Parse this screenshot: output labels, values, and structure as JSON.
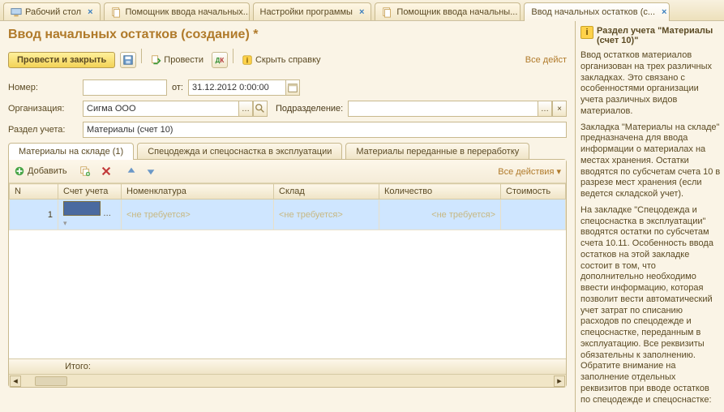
{
  "top_tabs": [
    {
      "label": "Рабочий стол",
      "closable": true,
      "icon": "desktop"
    },
    {
      "label": "Помощник ввода начальных...",
      "closable": true,
      "icon": "doclist"
    },
    {
      "label": "Настройки программы",
      "closable": true
    },
    {
      "label": "Помощник ввода начальны...",
      "closable": true,
      "icon": "doclist"
    },
    {
      "label": "Ввод начальных остатков (с...",
      "closable": true,
      "active": true
    }
  ],
  "page_title": "Ввод начальных остатков (создание) *",
  "toolbar": {
    "primary": "Провести и закрыть",
    "post": "Провести",
    "hide_help": "Скрыть справку",
    "all_actions": "Все дейст"
  },
  "fields": {
    "number_label": "Номер:",
    "number_value": "",
    "from_label": "от:",
    "date_value": "31.12.2012 0:00:00",
    "org_label": "Организация:",
    "org_value": "Сигма ООО",
    "dept_label": "Подразделение:",
    "dept_value": "",
    "section_label": "Раздел учета:",
    "section_value": "Материалы (счет 10)"
  },
  "subtabs": [
    "Материалы на складе (1)",
    "Спецодежда и спецоснастка в эксплуатации",
    "Материалы переданные в переработку"
  ],
  "grid_toolbar": {
    "add": "Добавить",
    "all_actions": "Все действия"
  },
  "grid": {
    "cols": [
      "N",
      "Счет учета",
      "Номенклатура",
      "Склад",
      "Количество",
      "Стоимость"
    ],
    "row": {
      "n": "1",
      "account": "",
      "nomen": "<не требуется>",
      "sklad": "<не требуется>",
      "qty": "<не требуется>",
      "cost": ""
    },
    "footer_label": "Итого:"
  },
  "help": {
    "title": "Раздел учета \"Материалы (счет 10)\"",
    "p1": "Ввод остатков материалов организован на трех различных закладках. Это связано с особенностями организации учета различных видов материалов.",
    "p2": "Закладка \"Материалы на складе\" предназначена для ввода информации о материалах на местах хранения. Остатки вводятся по субсчетам счета 10 в разрезе мест хранения (если ведется складской учет).",
    "p3": "На закладке \"Спецодежда и спецоснастка в эксплуатации\" вводятся остатки по субсчетам счета 10.11. Особенность ввода остатков на этой закладке состоит в том, что дополнительно необходимо ввести информацию, которая позволит вести автоматический учет затрат по списанию расходов по спецодежде и спецоснастке, переданным в эксплуатацию. Все реквизиты обязательны к заполнению. Обратите внимание на заполнение отдельных реквизитов при вводе остатков по спецодежде и спецоснастке:"
  }
}
